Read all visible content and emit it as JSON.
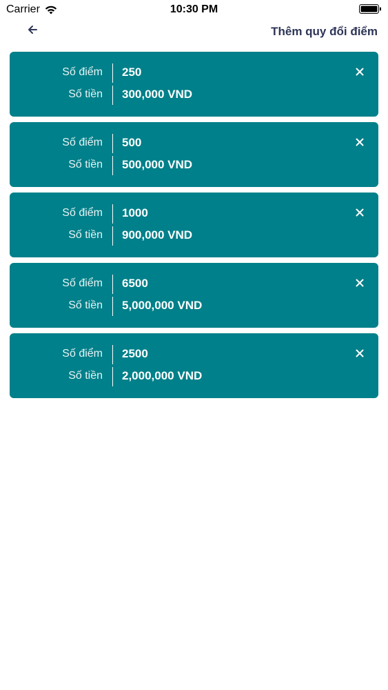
{
  "status_bar": {
    "carrier": "Carrier",
    "time": "10:30 PM",
    "wifi_icon": "wifi-icon",
    "battery_icon": "battery-icon"
  },
  "nav": {
    "back_icon": "arrow-left-icon",
    "title": "Thêm quy đổi điểm",
    "title_color": "#2e3557"
  },
  "colors": {
    "card_background": "#00808a",
    "text_on_card": "#ffffff"
  },
  "items": [
    {
      "points_label": "Số điểm",
      "points": "250",
      "money_label": "Số tiền",
      "money": "300,000 VND"
    },
    {
      "points_label": "Số điểm",
      "points": "500",
      "money_label": "Số tiền",
      "money": "500,000 VND"
    },
    {
      "points_label": "Số điểm",
      "points": "1000",
      "money_label": "Số tiền",
      "money": "900,000 VND"
    },
    {
      "points_label": "Số điểm",
      "points": "6500",
      "money_label": "Số tiền",
      "money": "5,000,000 VND"
    },
    {
      "points_label": "Số điểm",
      "points": "2500",
      "money_label": "Số tiền",
      "money": "2,000,000 VND"
    }
  ]
}
